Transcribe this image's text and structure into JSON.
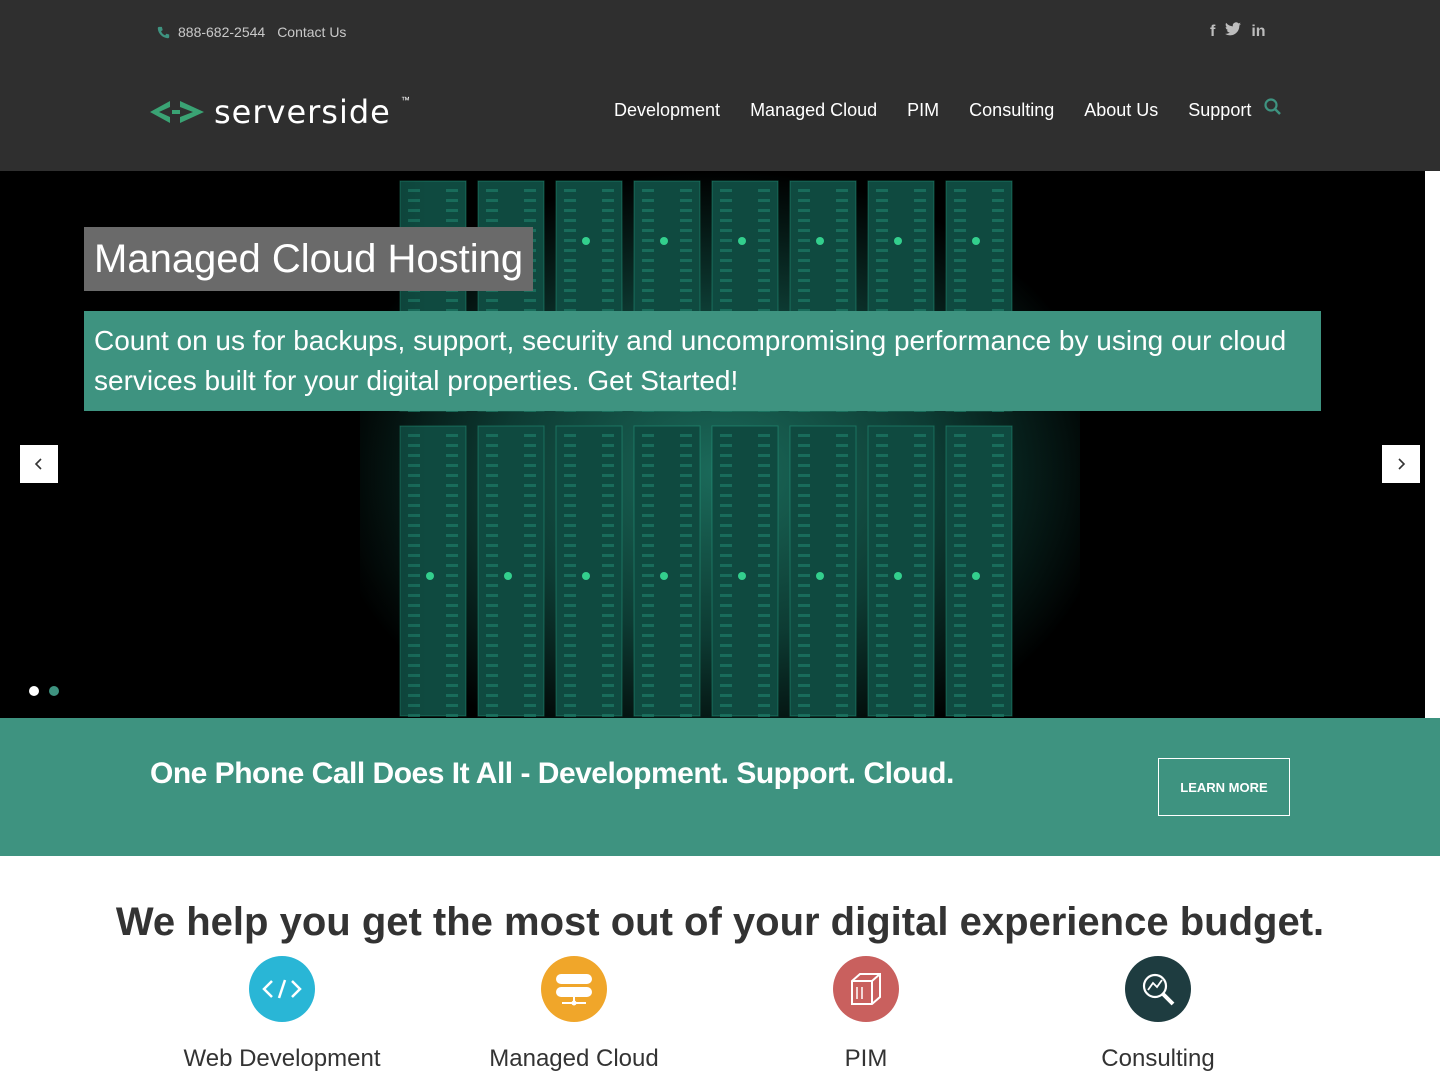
{
  "topbar": {
    "phone": "888-682-2544",
    "contact_label": "Contact Us",
    "socials": [
      "f",
      "t",
      "in"
    ]
  },
  "logo": {
    "text": "serverside",
    "tm": "™"
  },
  "nav": {
    "items": [
      "Development",
      "Managed Cloud",
      "PIM",
      "Consulting",
      "About Us",
      "Support"
    ]
  },
  "hero": {
    "title": "Managed Cloud Hosting",
    "subtitle": "Count on us for backups, support, security and uncompromising performance by using our cloud services built for your digital properties. Get Started!",
    "active_slide": 1,
    "slide_count": 2
  },
  "cta": {
    "text": "One Phone Call Does It All - Development. Support. Cloud.",
    "button_label": "LEARN MORE"
  },
  "services": {
    "headline": "We help you get the most out of your digital experience budget.",
    "items": [
      {
        "label": "Web Development",
        "icon": "code-icon",
        "color": "#29b6d6"
      },
      {
        "label": "Managed Cloud",
        "icon": "server-icon",
        "color": "#f0a62a"
      },
      {
        "label": "PIM",
        "icon": "box-icon",
        "color": "#c9605e"
      },
      {
        "label": "Consulting",
        "icon": "magnifier-chart-icon",
        "color": "#1e3c40"
      }
    ]
  },
  "colors": {
    "header_bg": "#2f2f2f",
    "accent": "#3e9380",
    "logo_green": "#3aa374"
  }
}
